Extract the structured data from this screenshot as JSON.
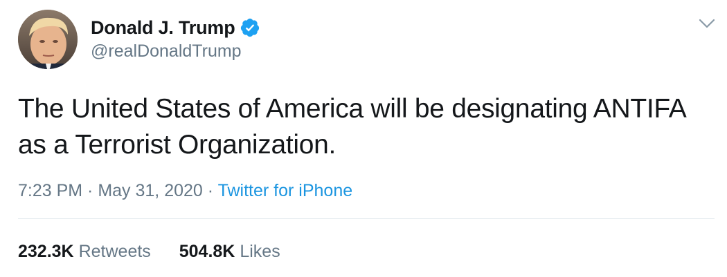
{
  "author": {
    "display_name": "Donald J. Trump",
    "handle": "@realDonaldTrump",
    "verified_icon": "verified-badge-icon",
    "avatar_icon": "profile-avatar"
  },
  "tweet": {
    "text": "The United States of America will be designating ANTIFA as a Terrorist Organization."
  },
  "meta": {
    "time": "7:23 PM",
    "separator": " · ",
    "date": "May 31, 2020",
    "source": "Twitter for iPhone"
  },
  "stats": {
    "retweets_count": "232.3K",
    "retweets_label": "Retweets",
    "likes_count": "504.8K",
    "likes_label": "Likes"
  },
  "colors": {
    "text_primary": "#14171a",
    "text_secondary": "#657786",
    "accent": "#1b95e0",
    "verified": "#1da1f2",
    "divider": "#e6ecf0"
  }
}
